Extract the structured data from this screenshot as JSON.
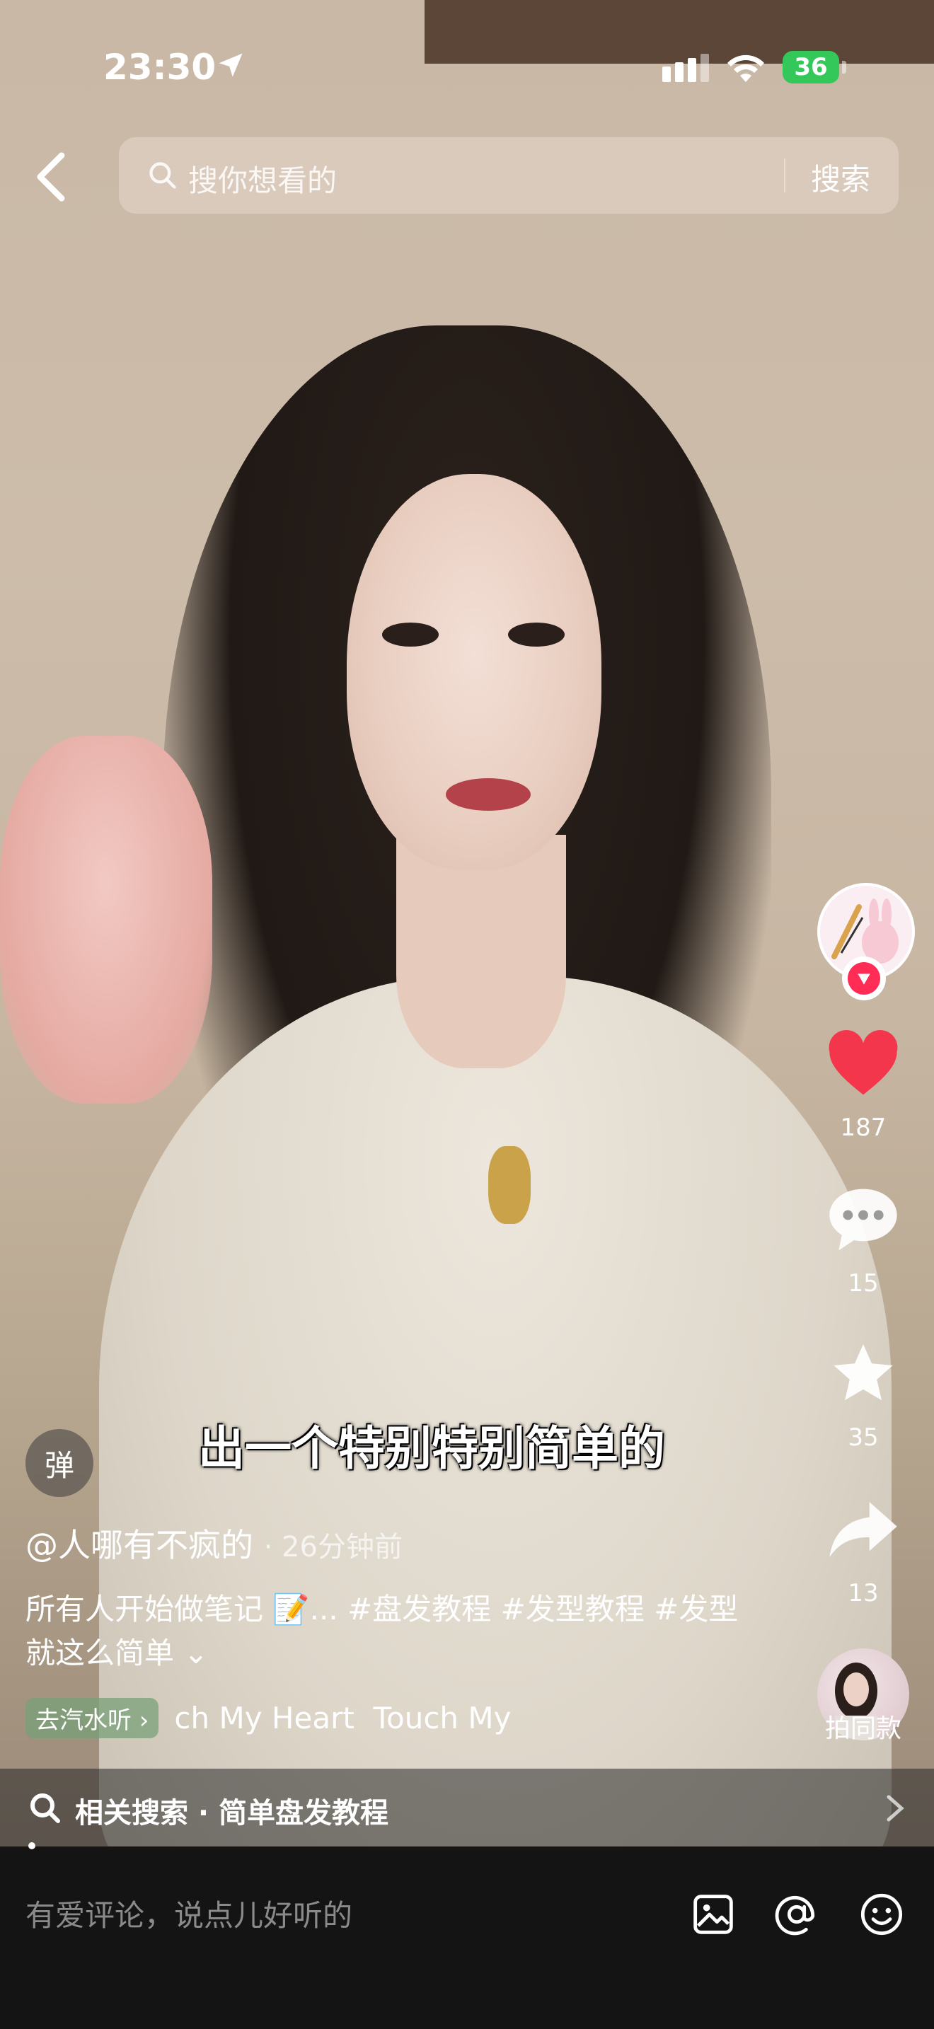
{
  "status_bar": {
    "time": "23:30",
    "battery": "36"
  },
  "search": {
    "placeholder": "搜你想看的",
    "button": "搜索"
  },
  "video": {
    "subtitle": "出一个特别特别简单的",
    "danmu_label": "弹"
  },
  "right_rail": {
    "like_count": "187",
    "comment_count": "15",
    "favorite_count": "35",
    "share_count": "13",
    "same_style_label": "拍同款"
  },
  "post": {
    "author": "@人哪有不疯的",
    "time": "· 26分钟前",
    "description": "所有人开始做笔记 📝... #盘发教程 #发型教程 #发型就这么简单 ⌄"
  },
  "music": {
    "chip_label": "去汽水听 ›",
    "title": "ch My Heart  Touch My"
  },
  "related_search": {
    "label": "相关搜索 · 简单盘发教程"
  },
  "comment_bar": {
    "placeholder": "有爱评论，说点儿好听的"
  },
  "colors": {
    "like_red": "#f4364c",
    "follow_red": "#ff2c55",
    "battery_green": "#34c759"
  }
}
